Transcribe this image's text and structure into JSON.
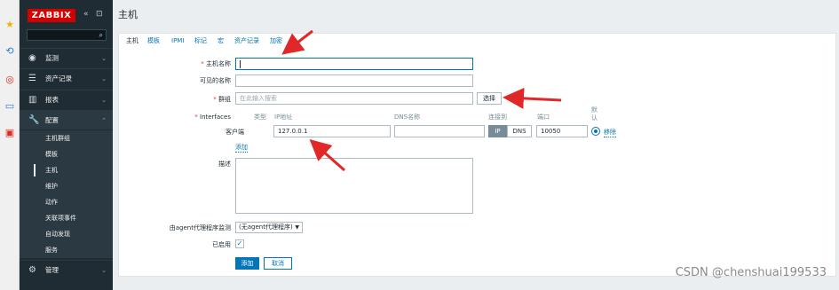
{
  "sidebar": {
    "logo": "ZABBIX",
    "collapse_icon": "«",
    "expand_icon": "⊡",
    "search_icon": "🔍",
    "menu": [
      {
        "label": "监测",
        "icon": "eye-icon"
      },
      {
        "label": "资产记录",
        "icon": "list-icon"
      },
      {
        "label": "报表",
        "icon": "chart-icon"
      },
      {
        "label": "配置",
        "icon": "wrench-icon"
      },
      {
        "label": "管理",
        "icon": "gear-icon"
      }
    ],
    "submenu": [
      "主机群组",
      "模板",
      "主机",
      "维护",
      "动作",
      "关联项事件",
      "自动发现",
      "服务"
    ]
  },
  "page": {
    "title": "主机"
  },
  "tabs": [
    "主机",
    "模板",
    "IPMI",
    "标记",
    "宏",
    "资产记录",
    "加密"
  ],
  "form": {
    "hostname_label": "主机名称",
    "hostname_value": "",
    "visible_name_label": "可见的名称",
    "visible_name_value": "",
    "groups_label": "群组",
    "groups_placeholder": "在此输入搜索",
    "select_button": "选择",
    "interfaces_label": "Interfaces",
    "col_type": "类型",
    "col_ip": "IP地址",
    "col_dns": "DNS名称",
    "col_connect": "连接到",
    "col_port": "端口",
    "col_default": "默认",
    "iface_type": "客户端",
    "iface_ip": "127.0.0.1",
    "iface_dns": "",
    "iface_ip_toggle": "IP",
    "iface_dns_toggle": "DNS",
    "iface_port": "10050",
    "remove_link": "移除",
    "add_link": "添加",
    "description_label": "描述",
    "proxy_label": "由agent代理程序监测",
    "proxy_value": "(无agent代理程序)",
    "enabled_label": "已启用",
    "enabled_checked": true,
    "add_button": "添加",
    "cancel_button": "取消"
  },
  "colors": {
    "sidebar_bg": "#1f2c33",
    "logo_red": "#d40000",
    "link_blue": "#0275b8",
    "arrow_red": "#e02828",
    "required_red": "#e33734"
  },
  "watermark": "CSDN @chenshuai199533"
}
